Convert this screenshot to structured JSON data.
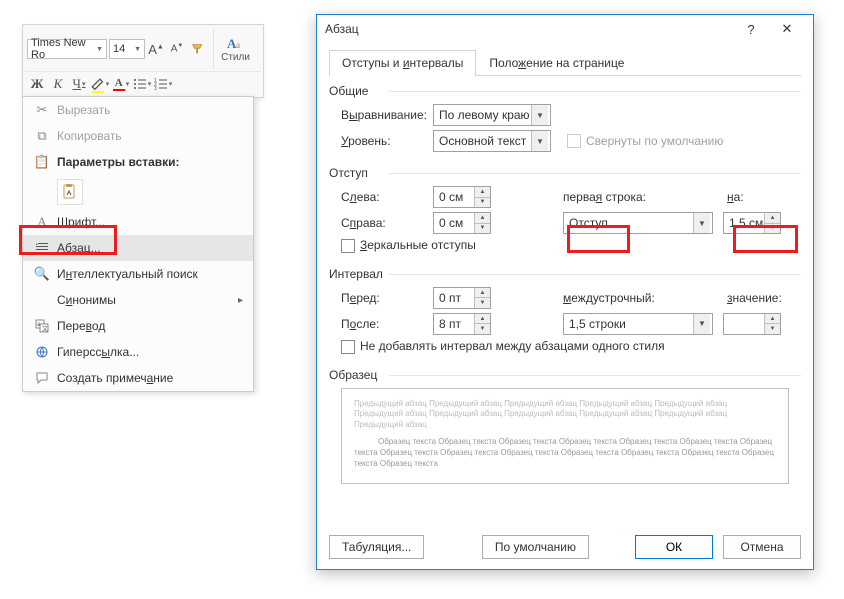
{
  "ribbon": {
    "font_name": "Times New Ro",
    "font_size": "14",
    "styles_label": "Стили",
    "grow_font": "A",
    "shrink_font": "A",
    "bold": "Ж",
    "italic": "К",
    "underline": "Ч"
  },
  "context_menu": {
    "cut": "Вырезать",
    "copy": "Копировать",
    "paste_header": "Параметры вставки:",
    "font": "Шрифт...",
    "paragraph": "Абзац...",
    "smart_lookup": "Интеллектуальный поиск",
    "synonyms": "Синонимы",
    "translate": "Перевод",
    "hyperlink": "Гиперссылка...",
    "new_comment": "Создать примечание"
  },
  "dialog": {
    "title": "Абзац",
    "tabs": {
      "indents": "Отступы и интервалы",
      "page": "Положение на странице"
    },
    "general": {
      "group": "Общие",
      "alignment_label": "Выравнивание:",
      "alignment_value": "По левому краю",
      "level_label": "Уровень:",
      "level_value": "Основной текст",
      "collapsed": "Свернуты по умолчанию"
    },
    "indent": {
      "group": "Отступ",
      "left_label": "Слева:",
      "left_value": "0 см",
      "right_label": "Справа:",
      "right_value": "0 см",
      "firstline_label": "первая строка:",
      "firstline_value": "Отступ",
      "by_label": "на:",
      "by_value": "1,5 см",
      "mirror": "Зеркальные отступы"
    },
    "spacing": {
      "group": "Интервал",
      "before_label": "Перед:",
      "before_value": "0 пт",
      "after_label": "После:",
      "after_value": "8 пт",
      "line_label": "междустрочный:",
      "line_value": "1,5 строки",
      "at_label": "значение:",
      "at_value": "",
      "nosame": "Не добавлять интервал между абзацами одного стиля"
    },
    "preview": {
      "group": "Образец",
      "prev_para": "Предыдущий абзац Предыдущий абзац Предыдущий абзац Предыдущий абзац Предыдущий абзац Предыдущий абзац Предыдущий абзац Предыдущий абзац Предыдущий абзац Предыдущий абзац Предыдущий абзац",
      "sample": "Образец текста Образец текста Образец текста Образец текста Образец текста Образец текста Образец текста Образец текста Образец текста Образец текста Образец текста Образец текста Образец текста Образец текста Образец текста"
    },
    "buttons": {
      "tabs": "Табуляция...",
      "default": "По умолчанию",
      "ok": "ОК",
      "cancel": "Отмена"
    }
  }
}
